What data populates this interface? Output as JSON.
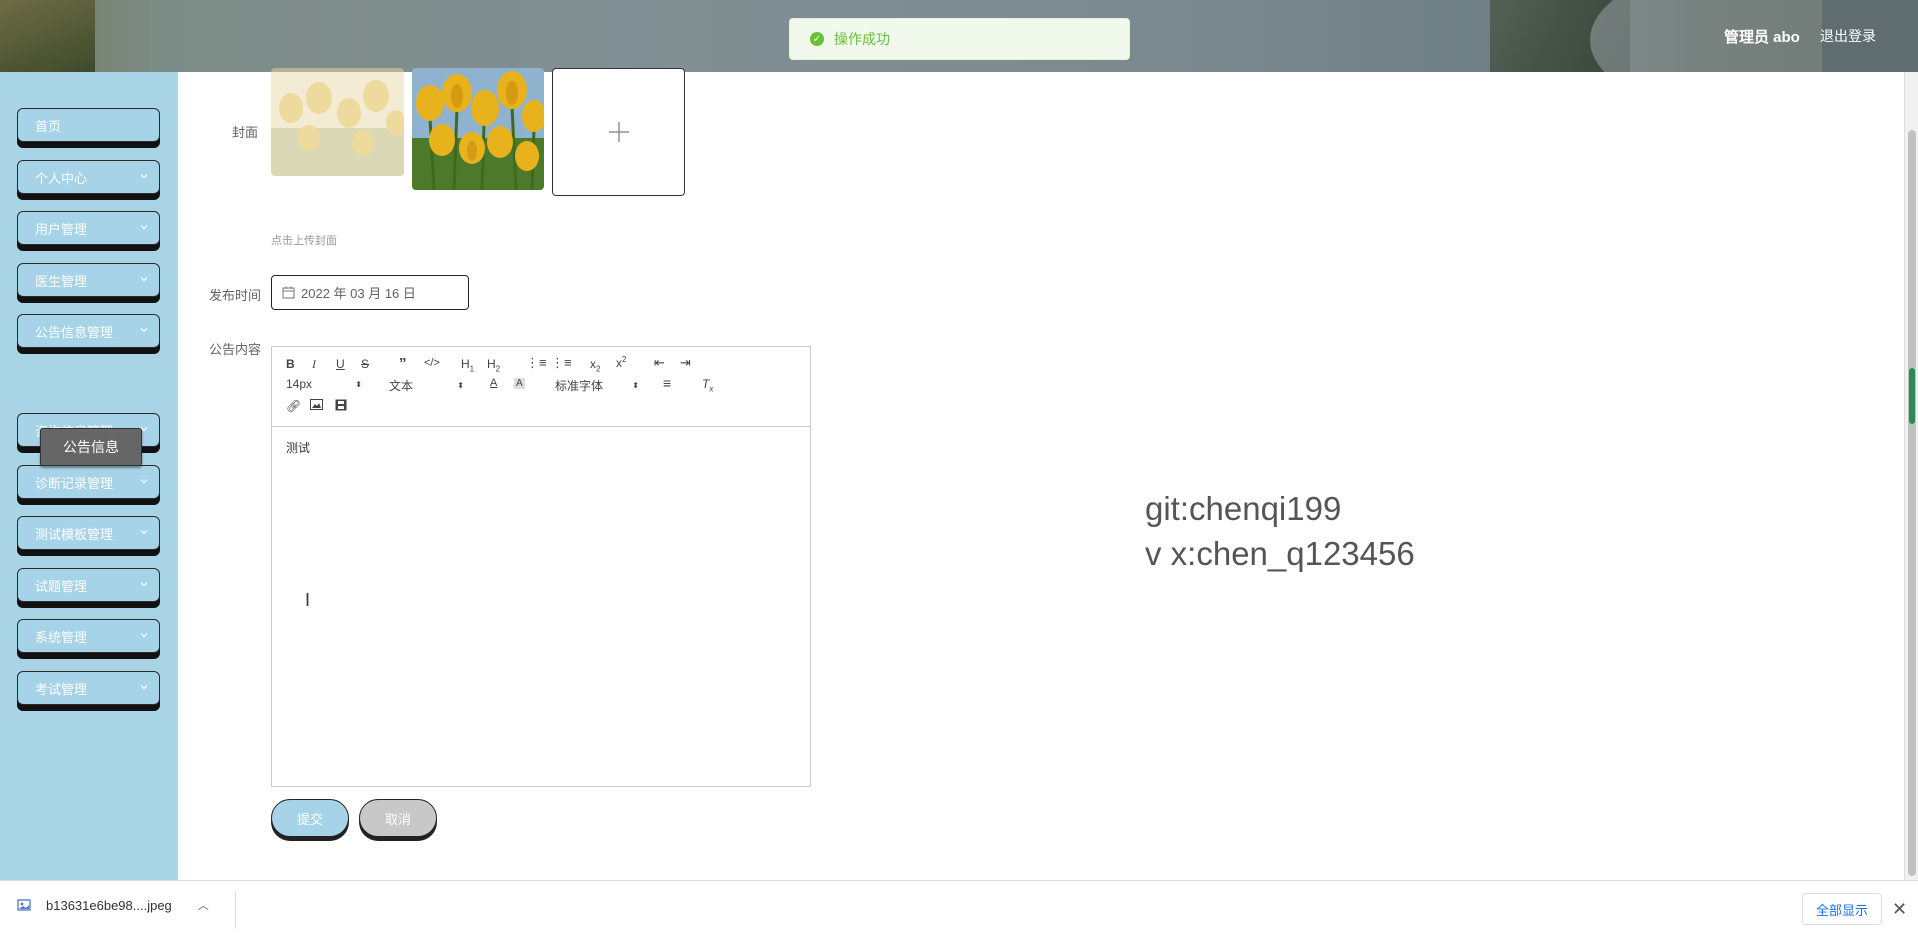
{
  "header": {
    "user_label": "管理员 abo",
    "logout": "退出登录",
    "toast": "操作成功"
  },
  "sidebar": {
    "items": [
      {
        "label": "首页",
        "has_arrow": false
      },
      {
        "label": "个人中心",
        "has_arrow": true
      },
      {
        "label": "用户管理",
        "has_arrow": true
      },
      {
        "label": "医生管理",
        "has_arrow": true
      },
      {
        "label": "公告信息管理",
        "has_arrow": true
      },
      {
        "label": "咨询信息管理",
        "has_arrow": true
      },
      {
        "label": "诊断记录管理",
        "has_arrow": true
      },
      {
        "label": "测试模板管理",
        "has_arrow": true
      },
      {
        "label": "试题管理",
        "has_arrow": true
      },
      {
        "label": "系统管理",
        "has_arrow": true
      },
      {
        "label": "考试管理",
        "has_arrow": true
      }
    ],
    "submenu": "公告信息"
  },
  "form": {
    "cover_label": "封面",
    "cover_hint": "点击上传封面",
    "date_label": "发布时间",
    "date_value": "2022 年 03 月 16 日",
    "content_label": "公告内容",
    "content_text": "测试",
    "submit": "提交",
    "cancel": "取消"
  },
  "editor": {
    "size_select": "14px",
    "header_select": "文本",
    "font_select": "标准字体"
  },
  "watermark": {
    "line1": "git:chenqi199",
    "line2": "v x:chen_q123456"
  },
  "downloads": {
    "file_name": "b13631e6be98....jpeg",
    "show_all": "全部显示"
  },
  "colors": {
    "sidebar_bg": "#a9d4e6",
    "success": "#67c23a"
  }
}
